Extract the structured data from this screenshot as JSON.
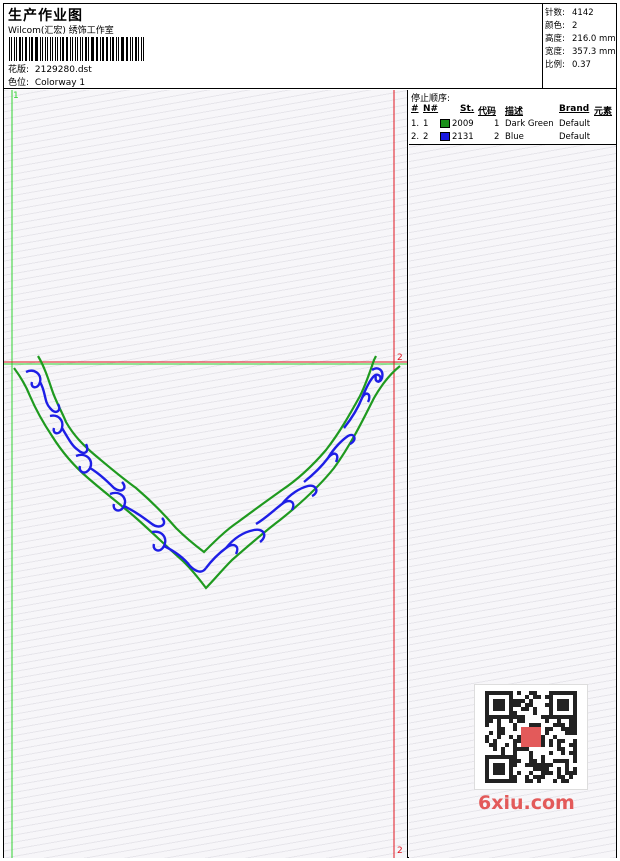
{
  "header": {
    "title": "生产作业图",
    "studio": "Wilcom(汇宏) 绣饰工作室",
    "design_label": "花版:",
    "design_file": "2129280.dst",
    "colorway_label": "色位:",
    "colorway": "Colorway 1"
  },
  "stats": {
    "stitches_label": "针数:",
    "stitches": "4142",
    "colors_label": "颜色:",
    "colors": "2",
    "height_label": "高度:",
    "height": "216.0 mm",
    "width_label": "宽度:",
    "width": "357.3 mm",
    "scale_label": "比例:",
    "scale": "0.37"
  },
  "stop_sequence": {
    "title": "停止顺序:",
    "headers": {
      "hash": "#",
      "no": "N#",
      "st": "St.",
      "code": "代码",
      "desc": "描述",
      "brand": "Brand",
      "element": "元素"
    },
    "rows": [
      {
        "hash": "1.",
        "no": "1",
        "color": "#1a8f1a",
        "st": "2009",
        "code": "1",
        "desc": "Dark Green",
        "brand": "Default"
      },
      {
        "hash": "2.",
        "no": "2",
        "color": "#1a1ae0",
        "st": "2131",
        "code": "2",
        "desc": "Blue",
        "brand": "Default"
      }
    ]
  },
  "design": {
    "marker_top_left": "1",
    "marker_mid_right": "2",
    "marker_bottom_right": "2",
    "outline_color": "#1f9a1f",
    "fill_color": "#1e1ee6",
    "guide_green": "#2fd12f",
    "guide_red": "#e0141e"
  },
  "watermark": {
    "site": "6xiu.com"
  }
}
